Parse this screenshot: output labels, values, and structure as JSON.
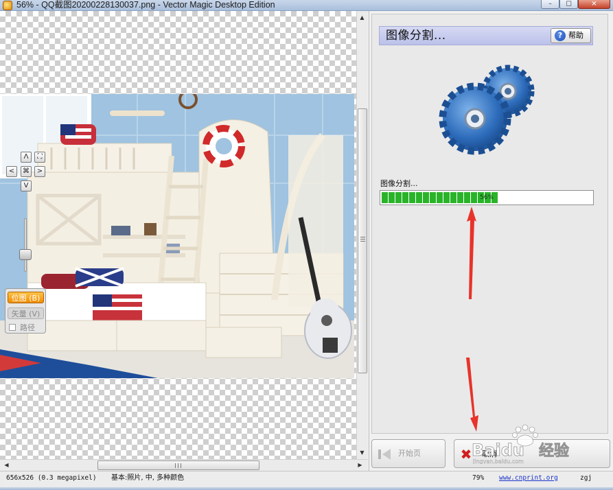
{
  "window": {
    "title": "56% - QQ截图20200228130037.png - Vector Magic Desktop Edition",
    "controls": {
      "minimize_icon": "minimize-icon",
      "maximize_icon": "maximize-icon",
      "close_icon": "close-icon"
    }
  },
  "canvas": {
    "image": "bunk-bed-room-photo",
    "nav": {
      "up": "Λ",
      "down": "V",
      "left": "<",
      "right": ">",
      "fit_icon": "fit-icon",
      "center_icon": "center-icon"
    },
    "view_modes": {
      "bitmap": "位图 (B)",
      "vector": "矢量 (V)",
      "path": "路径"
    }
  },
  "stage": {
    "title": "图像分割...",
    "help_label": "帮助",
    "illustration": "gears-icon",
    "progress_label": "图像分割...",
    "progress_text": "56%",
    "progress_value": 0.56
  },
  "buttons": {
    "start_label": "开始页",
    "cancel_label": "取消"
  },
  "watermark": {
    "brand": "Baidu",
    "brand_cn": "经验",
    "url": "jingyan.baidu.com"
  },
  "statusbar": {
    "dims": "656x526 (0.3 megapixel)",
    "mode": "基本:照片, 中, 多种颜色",
    "zoom": "79%",
    "link": "www.cnprint.org",
    "user": "zgj"
  },
  "colors": {
    "accent": "#f08c00",
    "progress": "#29b329",
    "header": "#bcc1ea",
    "arrow": "#e8332a"
  }
}
